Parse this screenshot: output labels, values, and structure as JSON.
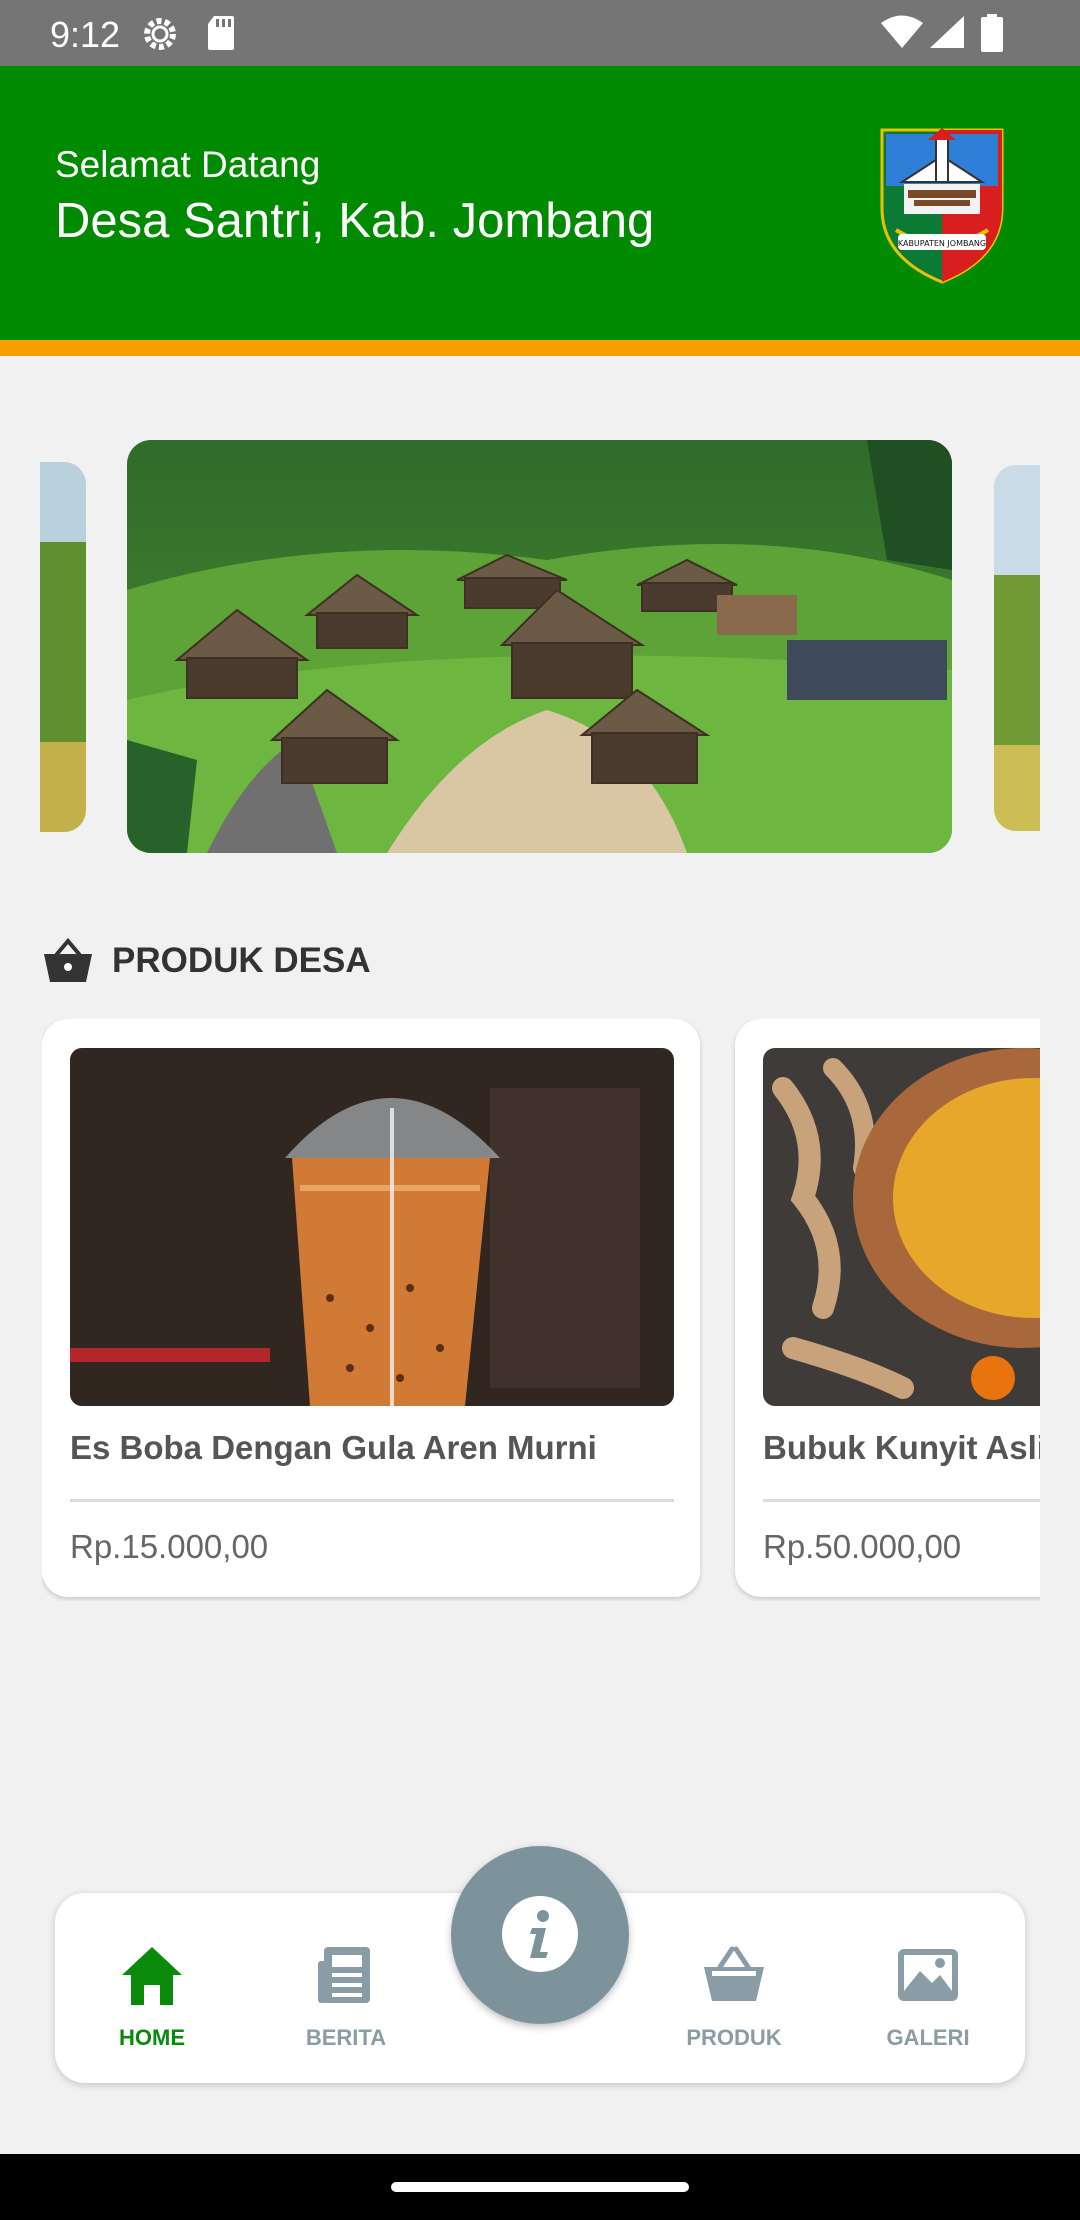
{
  "status_bar": {
    "time": "9:12",
    "icons": [
      "gear-icon",
      "sd-card-icon",
      "wifi-icon",
      "signal-icon",
      "battery-icon"
    ]
  },
  "header": {
    "greeting": "Selamat Datang",
    "village_name": "Desa Santri, Kab. Jombang",
    "logo_text": "KABUPATEN JOMBANG",
    "background_color": "#008a00",
    "accent_color": "#f5a000"
  },
  "carousel": {
    "slides": [
      "village-landscape-photo",
      "rice-field-photo",
      "rice-field-photo"
    ]
  },
  "products_section": {
    "icon": "shopping-basket-icon",
    "title": "PRODUK DESA",
    "items": [
      {
        "name": "Es Boba Dengan Gula Aren Murni",
        "price": "Rp.15.000,00",
        "image": "iced-boba-drink-photo"
      },
      {
        "name": "Bubuk Kunyit Asli",
        "price": "Rp.50.000,00",
        "image": "turmeric-powder-photo"
      }
    ]
  },
  "bottom_nav": {
    "active_color": "#0a8a0a",
    "inactive_color": "#8a9ca5",
    "items": [
      {
        "label": "HOME",
        "icon": "home-icon",
        "active": true
      },
      {
        "label": "BERITA",
        "icon": "newspaper-icon",
        "active": false
      },
      {
        "label": "PRODUK",
        "icon": "basket-icon",
        "active": false
      },
      {
        "label": "GALERI",
        "icon": "gallery-icon",
        "active": false
      }
    ],
    "fab_icon": "info-icon"
  }
}
